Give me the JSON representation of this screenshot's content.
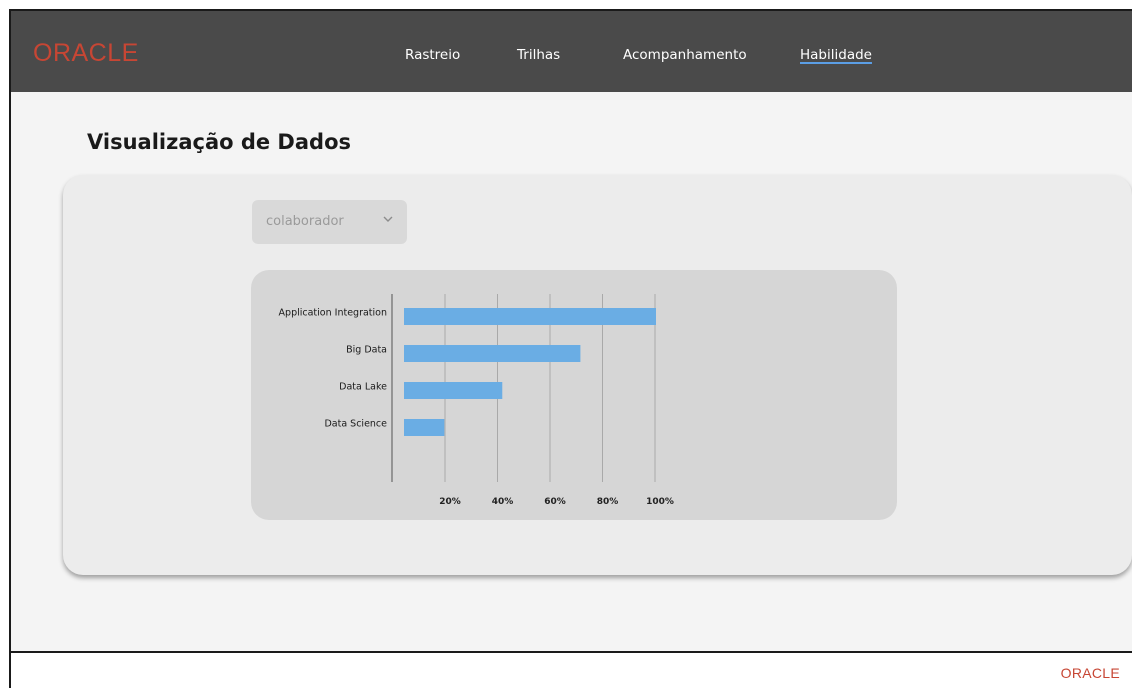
{
  "navbar": {
    "logo": "ORACLE",
    "links": [
      {
        "label": "Rastreio",
        "active": false
      },
      {
        "label": "Trilhas",
        "active": false
      },
      {
        "label": "Acompanhamento",
        "active": false
      },
      {
        "label": "Habilidade",
        "active": true
      }
    ]
  },
  "page": {
    "title": "Visualização de Dados"
  },
  "filter": {
    "selected": "colaborador"
  },
  "footer": {
    "logo": "ORACLE"
  },
  "colors": {
    "brand": "#c74634",
    "bar": "#6aade4",
    "navbar": "#4a4a4a"
  },
  "chart_data": {
    "type": "bar",
    "orientation": "horizontal",
    "categories": [
      "Application Integration",
      "Big Data",
      "Data Lake",
      "Data Science"
    ],
    "values": [
      100,
      70,
      39,
      16
    ],
    "xticks": [
      "20%",
      "40%",
      "60%",
      "80%",
      "100%"
    ],
    "xlim": [
      0,
      100
    ],
    "grid": true,
    "title": "",
    "xlabel": "",
    "ylabel": ""
  }
}
